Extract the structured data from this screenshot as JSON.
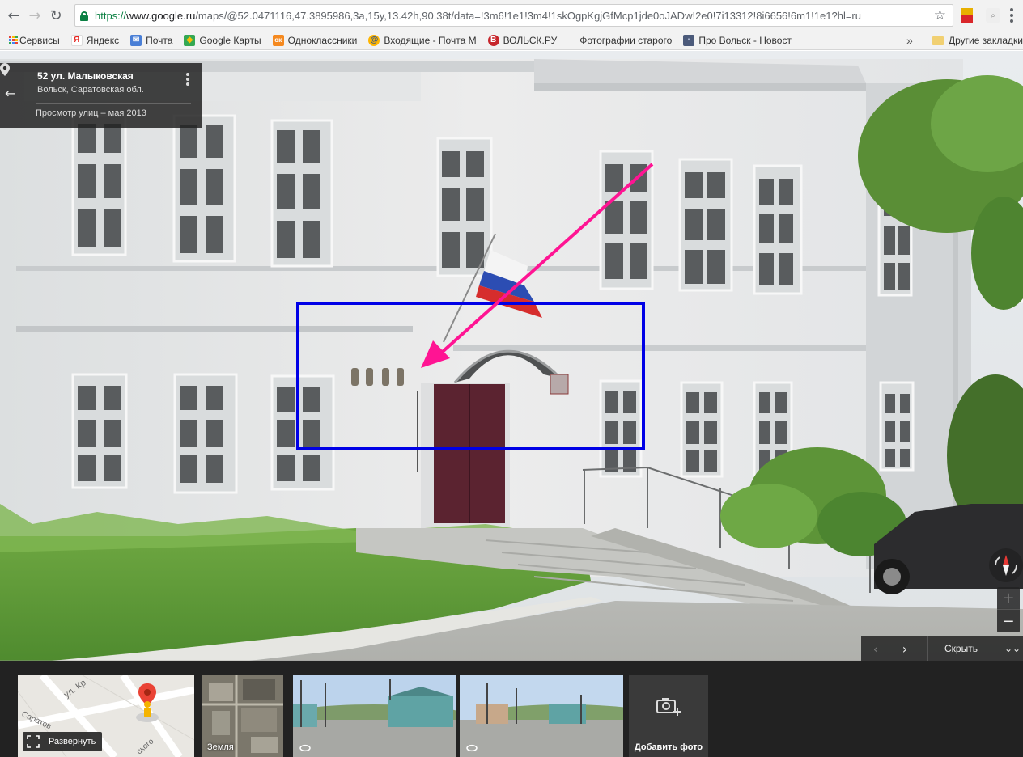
{
  "browser": {
    "url": {
      "scheme": "https://",
      "host": "www.google.ru",
      "path": "/maps/@52.0471116,47.3895986,3a,15y,13.42h,90.38t/data=!3m6!1e1!3m4!1skOgpKgjGfMcp1jde0oJADw!2e0!7i13312!8i6656!6m1!1e1?hl=ru"
    },
    "icons": {
      "back": "←",
      "forward": "→",
      "reload": "↻",
      "star": "☆",
      "ext2": "⌕"
    }
  },
  "bookmarks": {
    "items": [
      {
        "label": "Сервисы",
        "icon": "apps-icon"
      },
      {
        "label": "Яндекс",
        "icon": "yandex-icon",
        "glyph": "Я",
        "color": "#ffffff",
        "text_color": "#e52620"
      },
      {
        "label": "Почта",
        "icon": "mail-icon",
        "glyph": "✉",
        "color": "#4a7fd6",
        "text_color": "#ffffff"
      },
      {
        "label": "Google Карты",
        "icon": "google-maps-icon",
        "glyph": "◆",
        "color": "#34a853",
        "text_color": "#fbbc05"
      },
      {
        "label": "Одноклассники",
        "icon": "odnoklassniki-icon",
        "glyph": "ок",
        "color": "#f5891f",
        "text_color": "#ffffff"
      },
      {
        "label": "Входящие - Почта M",
        "icon": "mailru-icon",
        "glyph": "@",
        "color": "#ffb500",
        "text_color": "#1f4f9e"
      },
      {
        "label": "ВОЛЬСК.РУ",
        "icon": "volsk-icon",
        "glyph": "В",
        "color": "#c7262c",
        "text_color": "#ffffff"
      },
      {
        "label": "Фотографии старого",
        "icon": "",
        "glyph": "",
        "color": "",
        "text_color": ""
      },
      {
        "label": "Про Вольск - Новост",
        "icon": "pro-volsk-icon",
        "glyph": "▪",
        "color": "#4b5a7a",
        "text_color": "#aab4cc"
      }
    ],
    "more": "»",
    "other": "Другие закладки"
  },
  "streetview": {
    "card": {
      "back": "←",
      "title": "52 ул. Малыковская",
      "subtitle": "Вольск, Саратовская обл.",
      "date": "Просмотр улиц – мая 2013"
    },
    "controls": {
      "zoom_in": "+",
      "zoom_out": "−",
      "prev": "‹",
      "next": "›",
      "hide": "Скрыть",
      "hide_chevron": "⌄⌄"
    },
    "annotations": {
      "box_color": "#0000e6",
      "arrow_color": "#ff1493"
    }
  },
  "strip": {
    "expand": "Развернуть",
    "minimap_street": "ул. Кр",
    "minimap_street2": "Саратов",
    "minimap_street3": "ского",
    "earth": "Земля",
    "add_photo": "Добавить фото"
  }
}
